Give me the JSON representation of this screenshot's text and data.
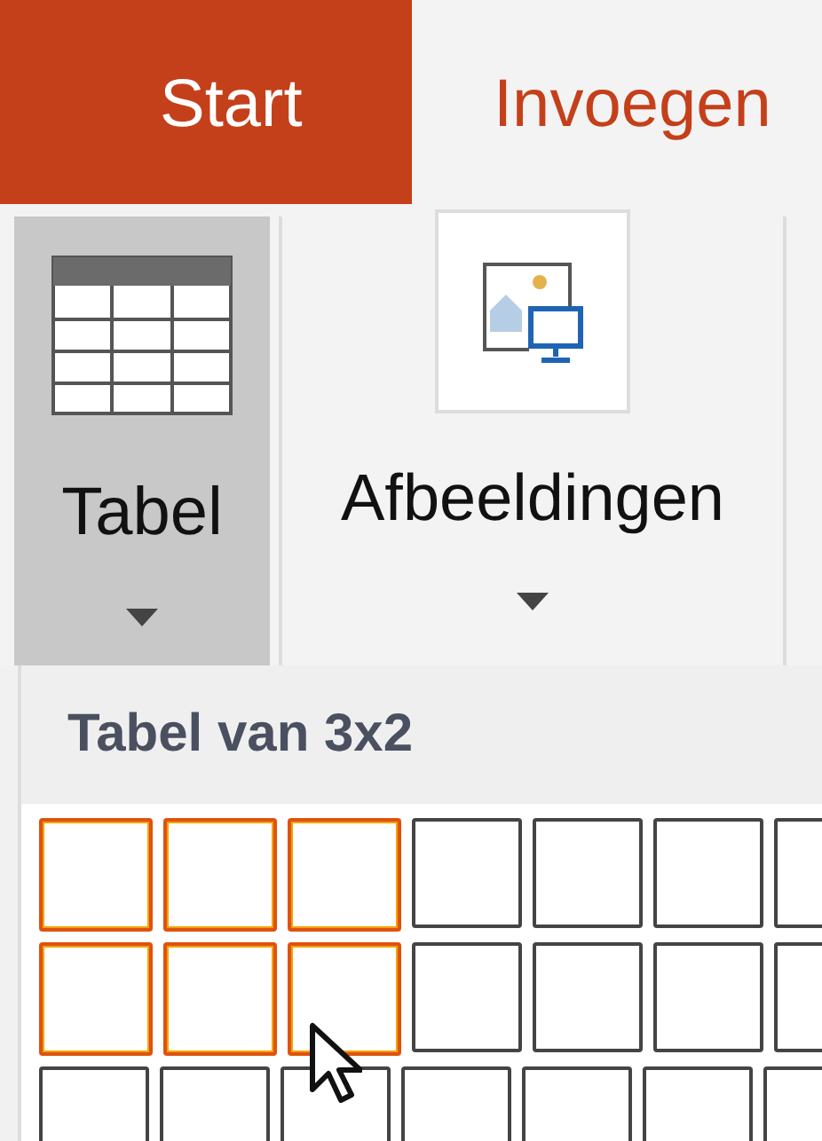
{
  "tabs": [
    {
      "label": "Start",
      "selected": true
    },
    {
      "label": "Invoegen",
      "selected": false
    }
  ],
  "ribbon": {
    "buttons": [
      {
        "label": "Tabel",
        "kind": "table",
        "pressed": true
      },
      {
        "label": "Afbeeldingen",
        "kind": "images",
        "pressed": false
      }
    ]
  },
  "table_dropdown": {
    "title": "Tabel van 3x2",
    "grid": [
      [
        {
          "selected": true
        },
        {
          "selected": true
        },
        {
          "selected": true
        },
        {
          "selected": false
        },
        {
          "selected": false
        },
        {
          "selected": false
        },
        {
          "selected": false
        }
      ],
      [
        {
          "selected": true
        },
        {
          "selected": true
        },
        {
          "selected": true
        },
        {
          "selected": false
        },
        {
          "selected": false
        },
        {
          "selected": false
        },
        {
          "selected": false
        }
      ],
      [
        {
          "selected": false
        },
        {
          "selected": false
        },
        {
          "selected": false
        },
        {
          "selected": false
        },
        {
          "selected": false
        },
        {
          "selected": false
        },
        {
          "selected": false
        }
      ]
    ]
  }
}
